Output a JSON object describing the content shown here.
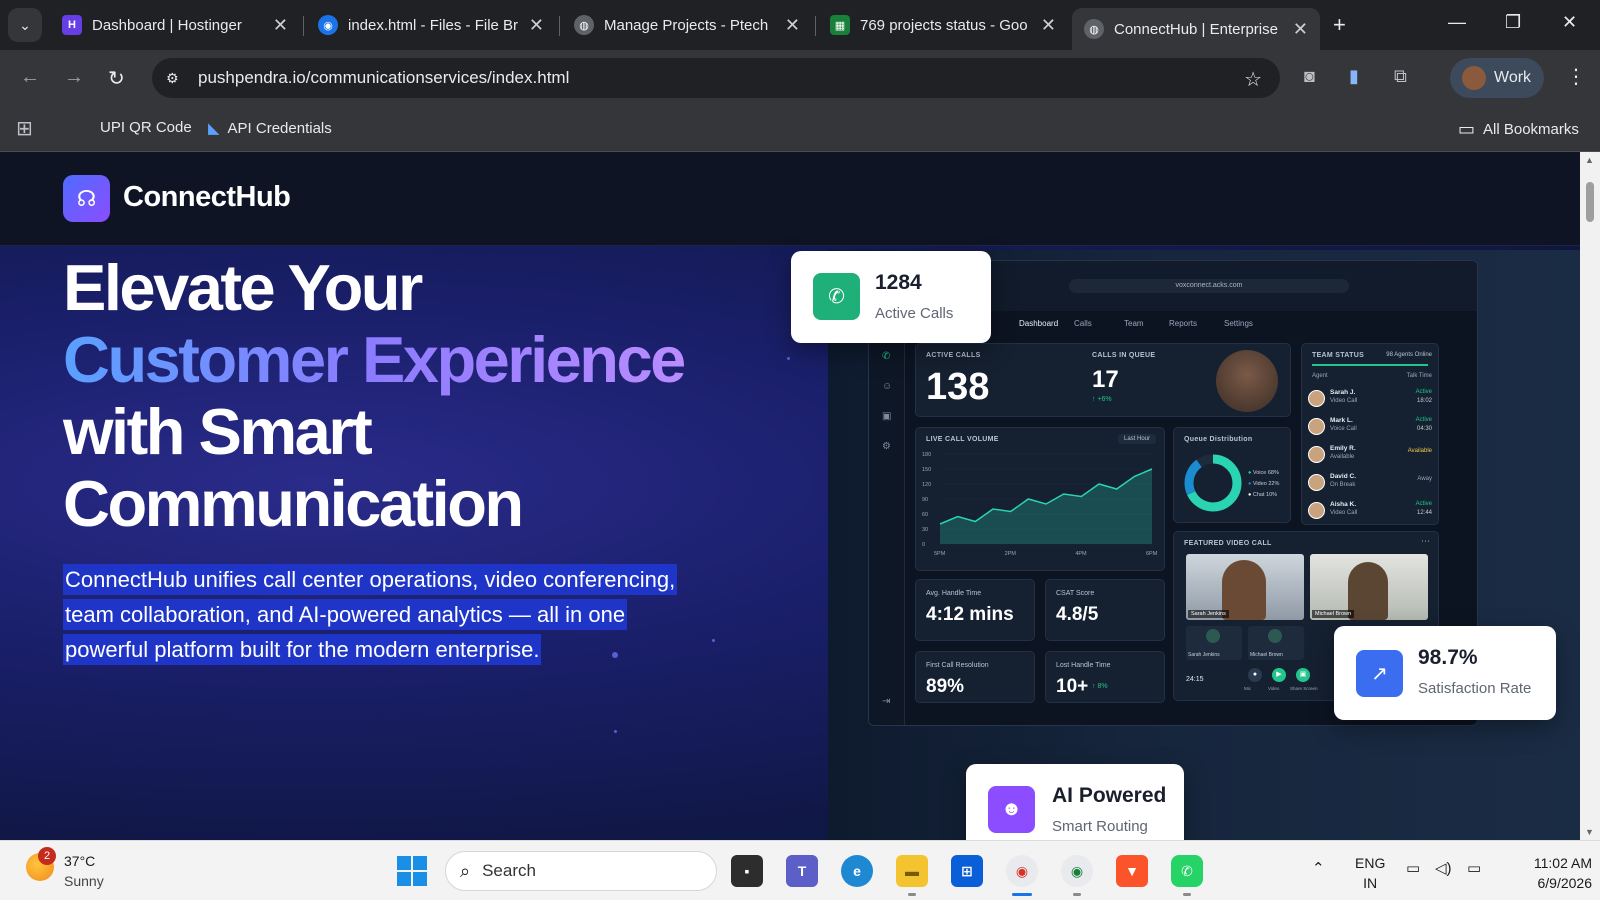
{
  "browser": {
    "tabs": [
      {
        "title": "Dashboard | Hostinger",
        "fav_color": "#673de6",
        "fav_glyph": "H"
      },
      {
        "title": "index.html - Files - File Br",
        "fav_color": "#1a73e8",
        "fav_glyph": "◉"
      },
      {
        "title": "Manage Projects - Ptech",
        "fav_color": "#5f6368",
        "fav_glyph": "◍"
      },
      {
        "title": "769 projects status - Goo",
        "fav_color": "#188038",
        "fav_glyph": "▦"
      },
      {
        "title": "ConnectHub | Enterprise",
        "fav_color": "#5f6368",
        "fav_glyph": "◍"
      }
    ],
    "url": "pushpendra.io/communicationservices/index.html",
    "profile_label": "Work",
    "bookmarks": [
      {
        "label": "UPI QR Code",
        "icon": "none"
      },
      {
        "label": "API Credentials",
        "icon": "n8n-icon"
      }
    ],
    "all_bookmarks_label": "All Bookmarks"
  },
  "site": {
    "brand": "ConnectHub",
    "hero": {
      "line1": "Elevate Your",
      "line2": "Customer Experience",
      "line3": "with Smart",
      "line4": "Communication",
      "subtitle": "ConnectHub unifies call center operations, video conferencing, team collaboration, and AI-powered analytics — all in one powerful platform built for the modern enterprise."
    },
    "float_cards": {
      "active_calls": {
        "value": "1284",
        "label": "Active Calls"
      },
      "satisfaction": {
        "value": "98.7%",
        "label": "Satisfaction Rate"
      },
      "ai": {
        "title": "AI Powered",
        "subtitle": "Smart Routing"
      }
    },
    "dashboard": {
      "url": "voxconnect.acks.com",
      "nav": [
        "Dashboard",
        "Calls",
        "Team",
        "Reports",
        "Settings"
      ],
      "active_calls_label": "ACTIVE CALLS",
      "active_calls_value": "138",
      "calls_in_queue_label": "CALLS IN QUEUE",
      "calls_in_queue_value": "17",
      "calls_in_queue_delta": "↑ +6%",
      "team_status_label": "TEAM STATUS",
      "agents_online": "98 Agents Online",
      "agent_header": "Agent",
      "talk_time_header": "Talk Time",
      "agents": [
        {
          "name": "Sarah J.",
          "role": "Video Call",
          "status": "Active",
          "time": "18:02",
          "color": "#22c58b"
        },
        {
          "name": "Mark L.",
          "role": "Voice Call",
          "status": "Active",
          "time": "04:30",
          "color": "#22c58b"
        },
        {
          "name": "Emily R.",
          "role": "Available",
          "status": "Available",
          "time": "",
          "color": "#f2c94c"
        },
        {
          "name": "David C.",
          "role": "On Break",
          "status": "Away",
          "time": "",
          "color": "#9aa6b8"
        },
        {
          "name": "Aisha K.",
          "role": "Video Call",
          "status": "Active",
          "time": "12:44",
          "color": "#22c58b"
        }
      ],
      "live_call_volume_label": "LIVE CALL VOLUME",
      "range_label": "Last Hour",
      "queue_distribution_label": "Queue Distribution",
      "queue_legend": [
        "Voice 68%",
        "Video 22%",
        "Chat 10%"
      ],
      "featured_video_label": "FEATURED VIDEO CALL",
      "video_participants": [
        "Sarah Jenkins",
        "Michael Brown"
      ],
      "video_small": [
        "Sarah Jenkins",
        "Michael Brown"
      ],
      "video_timer": "24:15",
      "video_controls": [
        "Mic",
        "Video",
        "Share Screen"
      ],
      "kpis": [
        {
          "label": "Avg. Handle Time",
          "value": "4:12 mins"
        },
        {
          "label": "CSAT Score",
          "value": "4.8/5"
        },
        {
          "label": "First Call Resolution",
          "value": "89%"
        },
        {
          "label": "Lost Handle Time",
          "value": "10+",
          "delta": "↑ 8%"
        }
      ]
    }
  },
  "chart_data": {
    "type": "area",
    "title": "LIVE CALL VOLUME",
    "x": [
      "5PM",
      "2PM",
      "4PM",
      "6PM"
    ],
    "y_ticks": [
      0,
      30,
      60,
      90,
      120,
      150,
      180
    ],
    "values": [
      40,
      55,
      45,
      70,
      65,
      90,
      80,
      100,
      95,
      120,
      110,
      135,
      150
    ],
    "ylim": [
      0,
      180
    ]
  },
  "taskbar": {
    "weather_temp": "37°C",
    "weather_cond": "Sunny",
    "weather_badge": "2",
    "search_label": "Search",
    "lang_top": "ENG",
    "lang_bottom": "IN",
    "time": "11:02 AM",
    "date": "6/9/2026"
  }
}
